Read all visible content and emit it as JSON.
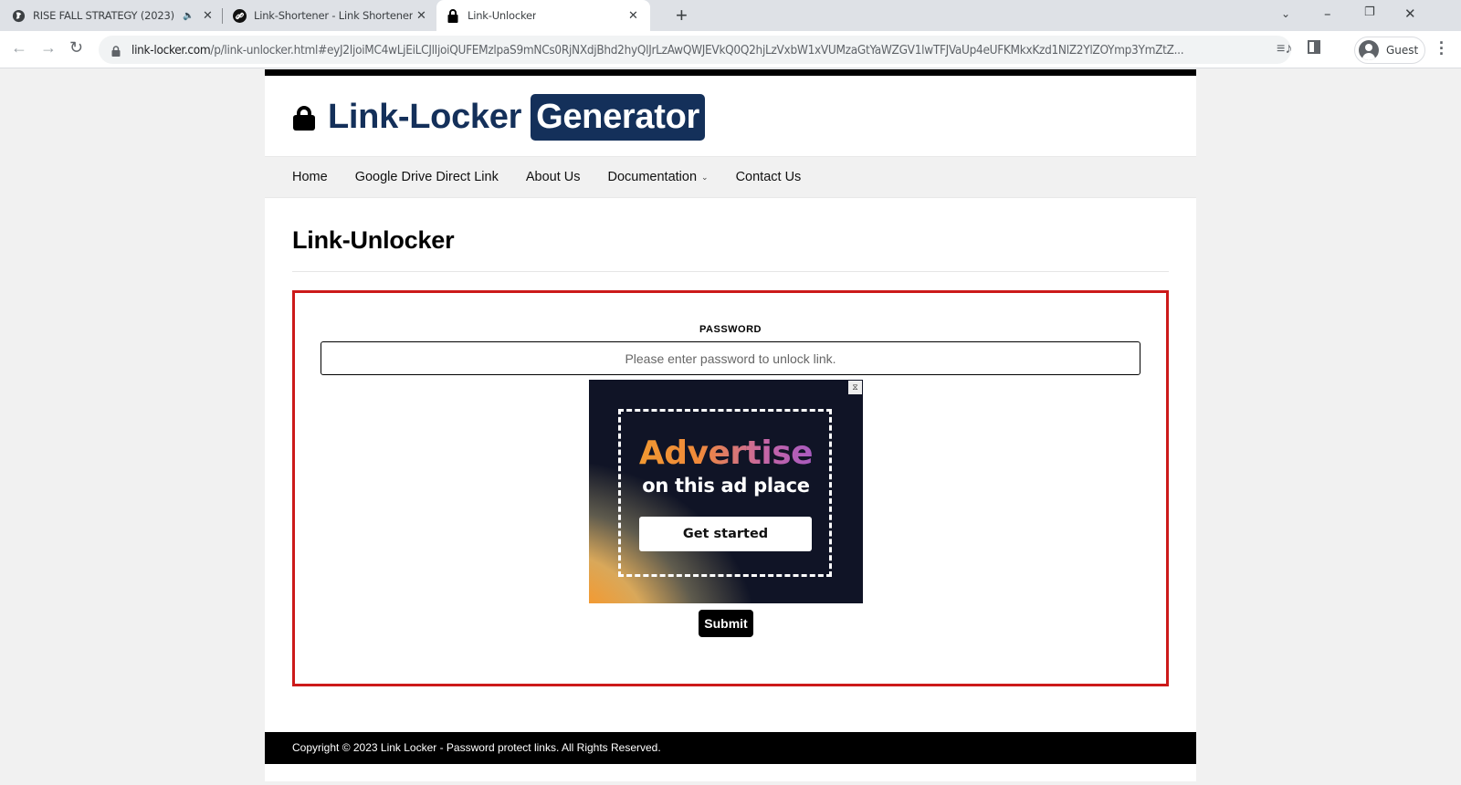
{
  "browser": {
    "tabs": [
      {
        "title": "RISE FALL STRATEGY (2023)",
        "icon": "globe-icon",
        "audio": true,
        "active": false
      },
      {
        "title": "Link-Shortener - Link Shortener",
        "icon": "link-icon",
        "audio": false,
        "active": false
      },
      {
        "title": "Link-Unlocker",
        "icon": "lock-icon",
        "audio": false,
        "active": true
      }
    ],
    "new_tab_label": "+",
    "url_host": "link-locker.com",
    "url_rest": "/p/link-unlocker.html#eyJ2IjoiMC4wLjEiLCJlIjoiQUFEMzlpaS9mNCs0RjNXdjBhd2hyQlJrLzAwQWJEVkQ0Q2hjLzVxbW1xVUMzaGtYaWZGV1lwTFJVaUp4eUFKMkxKzd1NlZ2YlZOYmp3YmZtZ...",
    "profile_label": "Guest"
  },
  "site": {
    "brand": "Link-Locker",
    "brand_badge": "Generator",
    "nav": [
      {
        "label": "Home"
      },
      {
        "label": "Google Drive Direct Link"
      },
      {
        "label": "About Us"
      },
      {
        "label": "Documentation",
        "has_dropdown": true
      },
      {
        "label": "Contact Us"
      }
    ],
    "page_title": "Link-Unlocker",
    "form": {
      "password_label": "PASSWORD",
      "password_value": "",
      "password_placeholder": "Please enter password to unlock link.",
      "submit_label": "Submit"
    },
    "ad": {
      "headline": "Advertise",
      "subline": "on this ad place",
      "cta_label": "Get started",
      "adchoices_icon": "adchoices-icon"
    },
    "footer_text": "Copyright © 2023 Link Locker - Password protect links. All Rights Reserved."
  },
  "colors": {
    "brand_navy": "#14305a",
    "frame_red": "#cc1a1a"
  }
}
